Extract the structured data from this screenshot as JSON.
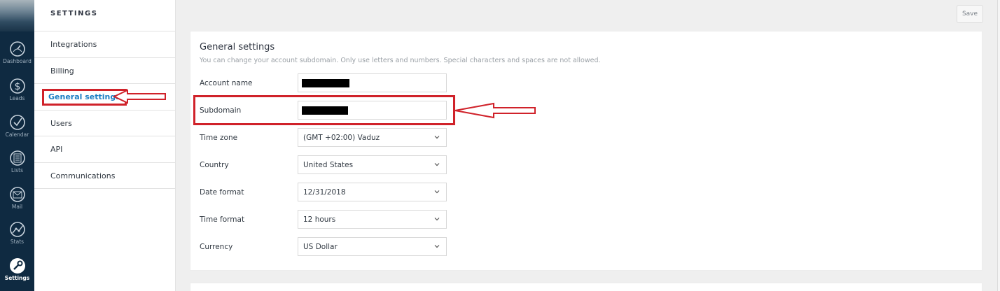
{
  "nav": {
    "items": [
      {
        "label": "Dashboard",
        "icon": "dashboard-icon"
      },
      {
        "label": "Leads",
        "icon": "dollar-icon"
      },
      {
        "label": "Calendar",
        "icon": "check-circle-icon"
      },
      {
        "label": "Lists",
        "icon": "list-icon"
      },
      {
        "label": "Mail",
        "icon": "mail-icon"
      },
      {
        "label": "Stats",
        "icon": "stats-icon"
      },
      {
        "label": "Settings",
        "icon": "wrench-icon",
        "active": true
      }
    ]
  },
  "settings_menu": {
    "title": "SETTINGS",
    "items": [
      {
        "label": "Integrations"
      },
      {
        "label": "Billing"
      },
      {
        "label": "General settings",
        "active": true
      },
      {
        "label": "Users"
      },
      {
        "label": "API"
      },
      {
        "label": "Communications"
      }
    ]
  },
  "toolbar": {
    "save_label": "Save"
  },
  "general": {
    "title": "General settings",
    "subtitle": "You can change your account subdomain. Only use letters and numbers. Special characters and spaces are not allowed.",
    "fields": {
      "account_name": {
        "label": "Account name"
      },
      "subdomain": {
        "label": "Subdomain"
      },
      "time_zone": {
        "label": "Time zone",
        "value": "(GMT +02:00) Vaduz"
      },
      "country": {
        "label": "Country",
        "value": "United States"
      },
      "date_format": {
        "label": "Date format",
        "value": "12/31/2018"
      },
      "time_format": {
        "label": "Time format",
        "value": "12 hours"
      },
      "currency": {
        "label": "Currency",
        "value": "US Dollar"
      }
    }
  },
  "colors": {
    "nav_bg": "#0f2a41",
    "accent": "#1c7fc4",
    "annotation_red": "#d0222a"
  }
}
